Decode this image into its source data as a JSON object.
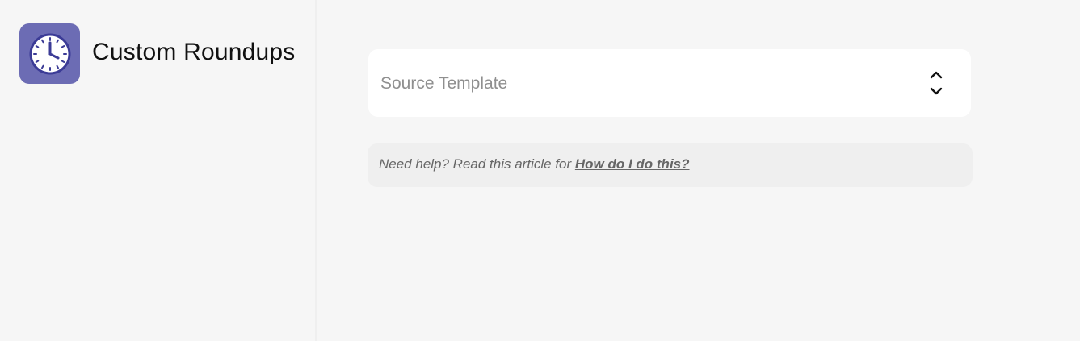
{
  "app": {
    "icon": "clock-icon",
    "title": "Custom Roundups",
    "accent_color": "#6c6cb4"
  },
  "form": {
    "source_template": {
      "placeholder": "Source Template",
      "value": "",
      "icon": "chevron-up-down-icon"
    }
  },
  "help": {
    "prefix": "Need help? Read this article for ",
    "link_label": "How do I do this?"
  }
}
